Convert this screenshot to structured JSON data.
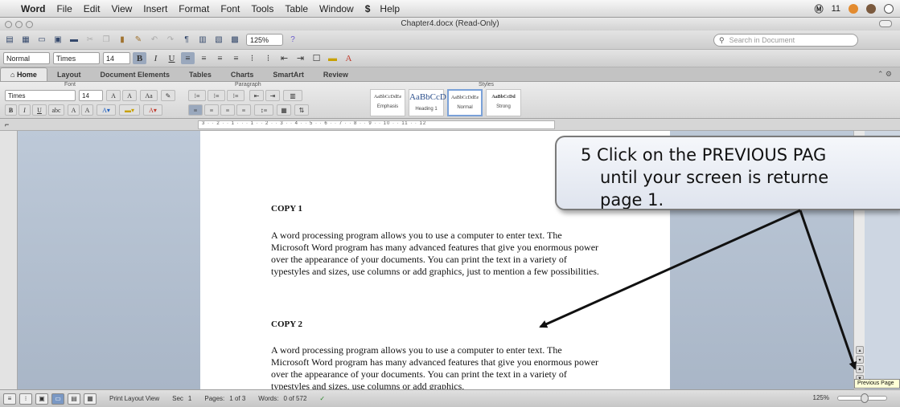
{
  "menubar": {
    "apple_glyph": "",
    "app_name": "Word",
    "items": [
      "File",
      "Edit",
      "View",
      "Insert",
      "Format",
      "Font",
      "Tools",
      "Table",
      "Window"
    ],
    "script_glyph": "$",
    "help": "Help",
    "right_label": "11"
  },
  "window": {
    "title": "Chapter4.docx (Read-Only)"
  },
  "std_toolbar": {
    "zoom": "125%",
    "search_placeholder": "Search in Document"
  },
  "fmt_toolbar": {
    "style": "Normal",
    "font": "Times",
    "size": "14",
    "bold": "B",
    "italic": "I",
    "underline": "U"
  },
  "ribbon_tabs": {
    "items": [
      "Home",
      "Layout",
      "Document Elements",
      "Tables",
      "Charts",
      "SmartArt",
      "Review"
    ],
    "active": "Home"
  },
  "ribbon": {
    "groups": {
      "font": "Font",
      "paragraph": "Paragraph",
      "styles": "Styles"
    },
    "font_name": "Times",
    "font_size": "14",
    "styles": [
      {
        "sample": "AaBbCcDdEe",
        "name": "Emphasis"
      },
      {
        "sample": "AaBbCcD",
        "name": "Heading 1"
      },
      {
        "sample": "AaBbCcDdEe",
        "name": "Normal"
      },
      {
        "sample": "AaBbCcDd",
        "name": "Strong"
      }
    ]
  },
  "ruler": {
    "ticks": "3 · · 2 · · 1 · · · 1 · · 2 · · 3 · · 4 · · 5 · · 6 · · 7 · · 8 · · 9 · · 10 · · 11 · · 12"
  },
  "document": {
    "heading1": "COPY 1",
    "para1": "A word processing program allows you to use a computer to enter text. The Microsoft Word program has many advanced features that give you enormous power over the appearance of your documents.  You can print the text in a variety of typestyles and sizes, use columns or add graphics, just to mention a few possibilities.",
    "heading2": "COPY 2",
    "para2": "A word processing program allows you to use a computer to enter text. The Microsoft Word program has many advanced features that give you enormous power over the appearance of your documents.  You can print the text in a variety of typestyles and sizes, use columns or add graphics,"
  },
  "statusbar": {
    "view": "Print Layout View",
    "sec_label": "Sec",
    "sec_value": "1",
    "pages_label": "Pages:",
    "pages_value": "1 of 3",
    "words_label": "Words:",
    "words_value": "0 of 572",
    "zoom": "125%"
  },
  "tooltip": {
    "text": "Previous Page"
  },
  "callout": {
    "line1": "5 Click on the PREVIOUS PAG",
    "line2": "until your screen is returne",
    "line3": "page 1."
  },
  "colors": {
    "accent": "#7a98c4",
    "doc_bg": "#b3c0d0",
    "callout_border": "#7a7a7a"
  }
}
